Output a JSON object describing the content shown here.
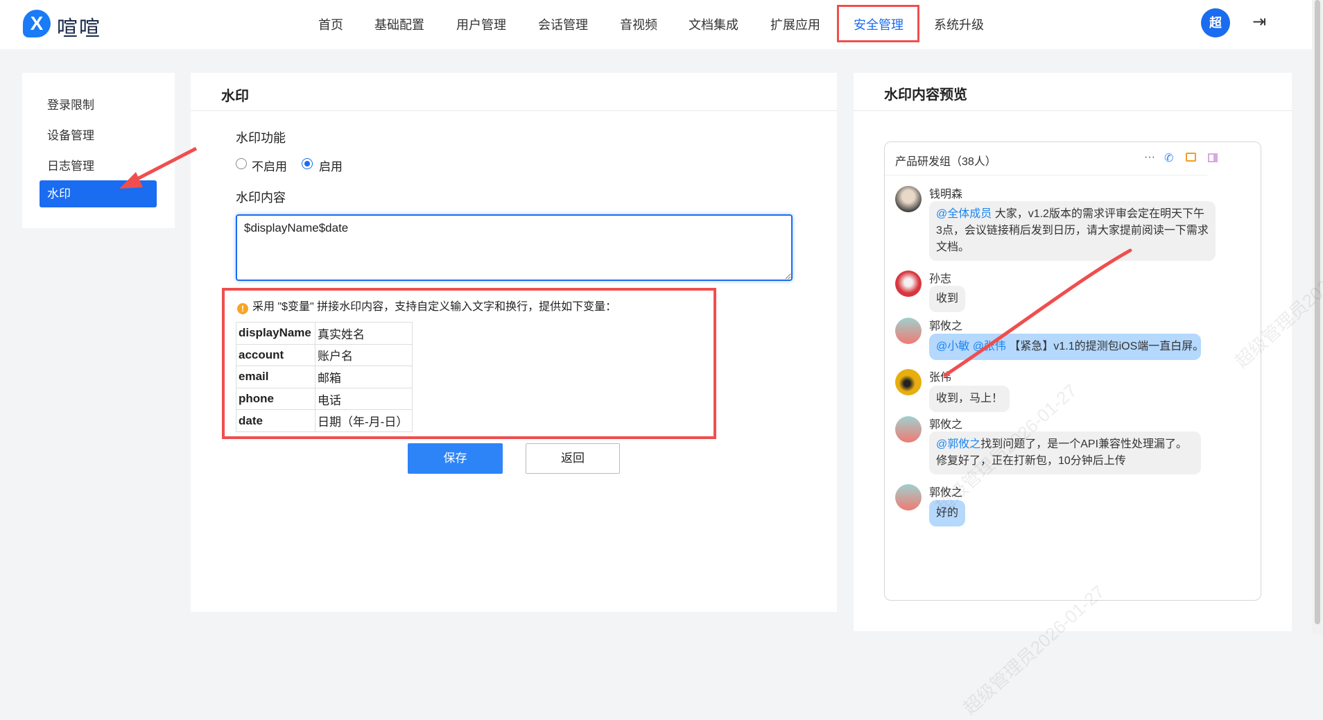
{
  "brand": {
    "name": "喧喧",
    "logo_letter": "X"
  },
  "nav": {
    "items": [
      "首页",
      "基础配置",
      "用户管理",
      "会话管理",
      "音视频",
      "文档集成",
      "扩展应用",
      "安全管理",
      "系统升级"
    ],
    "active": "安全管理"
  },
  "user": {
    "avatar_text": "超",
    "logout_icon": "logout-icon"
  },
  "sidebar": {
    "items": [
      "登录限制",
      "设备管理",
      "日志管理",
      "水印"
    ],
    "active": "水印"
  },
  "form": {
    "title": "水印",
    "feature_label": "水印功能",
    "options": [
      "不启用",
      "启用"
    ],
    "selected": "启用",
    "content_label": "水印内容",
    "content_value": "$displayName$date",
    "hint": "采用 \"$变量\" 拼接水印内容，支持自定义输入文字和换行，提供如下变量：",
    "variables": [
      {
        "key": "displayName",
        "desc": "真实姓名"
      },
      {
        "key": "account",
        "desc": "账户名"
      },
      {
        "key": "email",
        "desc": "邮箱"
      },
      {
        "key": "phone",
        "desc": "电话"
      },
      {
        "key": "date",
        "desc": "日期（年-月-日）"
      }
    ],
    "save_label": "保存",
    "back_label": "返回"
  },
  "preview": {
    "title": "水印内容预览",
    "chat_title": "产品研发组（38人）",
    "watermark": "超级管理员2026-01-27",
    "messages": [
      {
        "name": "钱明森",
        "mention": "@全体成员",
        "text": " 大家，v1.2版本的需求评审会定在明天下午3点，会议链接稍后发到日历，请大家提前阅读一下需求文档。"
      },
      {
        "name": "孙志",
        "mention": "",
        "text": "收到"
      },
      {
        "name": "郭攸之",
        "mention": "@小敏 @张伟",
        "text": " 【紧急】v1.1的提测包iOS端一直白屏。"
      },
      {
        "name": "张伟",
        "mention": "",
        "text": "收到，马上！"
      },
      {
        "name": "郭攸之",
        "mention": "@郭攸之",
        "text": "找到问题了，是一个API兼容性处理漏了。修复好了，正在打新包，10分钟后上传"
      },
      {
        "name": "郭攸之",
        "mention": "",
        "text": "好的"
      }
    ]
  },
  "colors": {
    "accent": "#1a6cf0",
    "annotation": "#f04e4e",
    "mention": "#1a84f0",
    "bubble_self": "#b5d8fd"
  }
}
